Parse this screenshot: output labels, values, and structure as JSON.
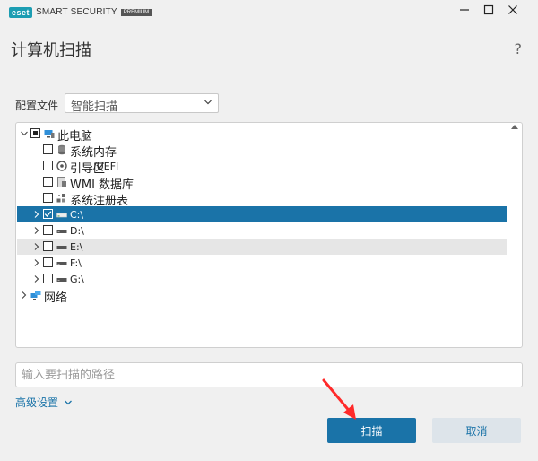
{
  "window": {
    "brand_logo": "eset",
    "brand_text": "SMART SECURITY",
    "brand_badge": "PREMIUM",
    "minimize_icon": "minimize-icon",
    "maximize_icon": "maximize-icon",
    "close_icon": "close-icon"
  },
  "page": {
    "title": "计算机扫描",
    "help": "?"
  },
  "profile": {
    "label": "配置文件",
    "selected": "智能扫描"
  },
  "tree": {
    "items": [
      {
        "label": "此电脑",
        "icon": "computer-icon",
        "state": "partial",
        "expandable": true,
        "expanded": true
      },
      {
        "label": "系统内存",
        "icon": "memory-icon",
        "state": "unchecked",
        "expandable": false
      },
      {
        "label": "引导区",
        "label_suffix": "/UEFI",
        "icon": "boot-sector-icon",
        "state": "unchecked",
        "expandable": false
      },
      {
        "label": "WMI 数据库",
        "icon": "database-icon",
        "state": "unchecked",
        "expandable": false
      },
      {
        "label": "系统注册表",
        "icon": "registry-icon",
        "state": "unchecked",
        "expandable": false
      },
      {
        "label": "C:\\",
        "icon": "drive-icon",
        "state": "checked",
        "expandable": true,
        "selected": true
      },
      {
        "label": "D:\\",
        "icon": "drive-icon",
        "state": "unchecked",
        "expandable": true
      },
      {
        "label": "E:\\",
        "icon": "drive-icon",
        "state": "unchecked",
        "expandable": true,
        "hover": true
      },
      {
        "label": "F:\\",
        "icon": "drive-icon",
        "state": "unchecked",
        "expandable": true
      },
      {
        "label": "G:\\",
        "icon": "drive-icon",
        "state": "unchecked",
        "expandable": true
      },
      {
        "label": "网络",
        "icon": "network-icon",
        "expandable": true
      }
    ]
  },
  "path_input": {
    "placeholder": "输入要扫描的路径",
    "value": ""
  },
  "advanced": {
    "label": "高级设置"
  },
  "buttons": {
    "scan": "扫描",
    "cancel": "取消"
  },
  "colors": {
    "accent": "#1a73a8",
    "brand": "#1c9db2",
    "annotation_arrow": "#ff2a2a"
  }
}
